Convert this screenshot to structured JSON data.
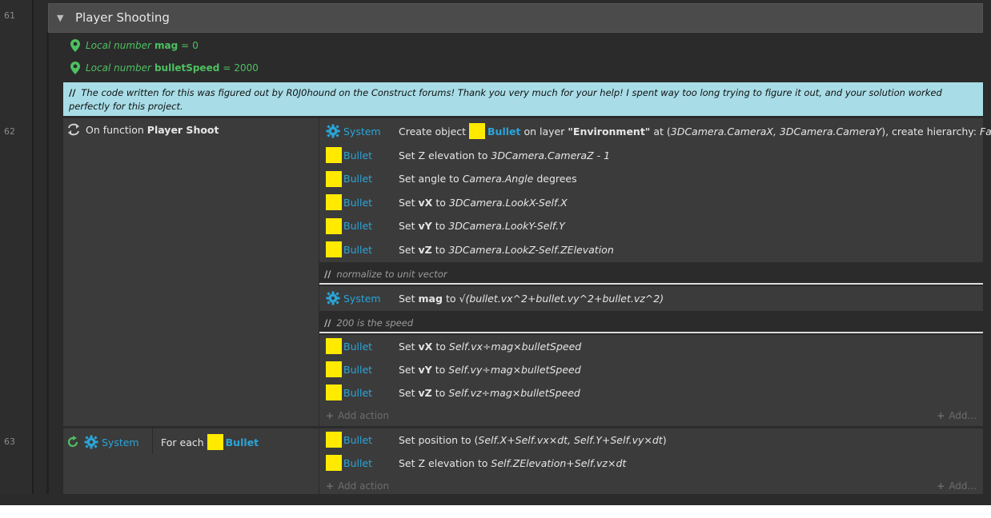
{
  "line_numbers": {
    "group": "61",
    "event62": "62",
    "event63": "63"
  },
  "group": {
    "title": "Player Shooting"
  },
  "local_vars": [
    {
      "prefix": "Local number",
      "name": "mag",
      "eq": "=",
      "value": "0"
    },
    {
      "prefix": "Local number",
      "name": "bulletSpeed",
      "eq": "=",
      "value": "2000"
    }
  ],
  "comment": {
    "slashes": "//",
    "text": "The code written for this was figured out by R0J0hound on the Construct forums! Thank you very much for your help! I spent way too long trying to figure it out, and your solution worked perfectly for this project."
  },
  "event62": {
    "condition_prefix": "On function",
    "function_name": "Player Shoot",
    "create_action": {
      "object": "System",
      "t1": "Create object",
      "obj": "Bullet",
      "t2": "on layer",
      "layer": "\"Environment\"",
      "t3": "at (",
      "coords": "3DCamera.CameraX, 3DCamera.CameraY",
      "t4": "), create hierarchy:",
      "hierarchy": "False"
    },
    "actions_a": [
      {
        "object": "Bullet",
        "pre": "Set Z elevation to",
        "bold": "",
        "mid": "",
        "expr": "3DCamera.CameraZ - 1",
        "post": ""
      },
      {
        "object": "Bullet",
        "pre": "Set angle to",
        "bold": "",
        "mid": "",
        "expr": "Camera.Angle",
        "post": "degrees"
      },
      {
        "object": "Bullet",
        "pre": "Set",
        "bold": "vX",
        "mid": "to",
        "expr": "3DCamera.LookX-Self.X",
        "post": ""
      },
      {
        "object": "Bullet",
        "pre": "Set",
        "bold": "vY",
        "mid": "to",
        "expr": "3DCamera.LookY-Self.Y",
        "post": ""
      },
      {
        "object": "Bullet",
        "pre": "Set",
        "bold": "vZ",
        "mid": "to",
        "expr": "3DCamera.LookZ-Self.ZElevation",
        "post": ""
      }
    ],
    "comment_normalize": "normalize to unit vector",
    "mag_action": {
      "object": "System",
      "pre": "Set",
      "bold": "mag",
      "mid": "to",
      "expr": "√(bullet.vx^2+bullet.vy^2+bullet.vz^2)"
    },
    "comment_speed": "200 is the speed",
    "actions_b": [
      {
        "object": "Bullet",
        "pre": "Set",
        "bold": "vX",
        "mid": "to",
        "expr": "Self.vx÷mag×bulletSpeed"
      },
      {
        "object": "Bullet",
        "pre": "Set",
        "bold": "vY",
        "mid": "to",
        "expr": "Self.vy÷mag×bulletSpeed"
      },
      {
        "object": "Bullet",
        "pre": "Set",
        "bold": "vZ",
        "mid": "to",
        "expr": "Self.vz÷mag×bulletSpeed"
      }
    ],
    "add_action": "Add action",
    "add_more": "Add..."
  },
  "event63": {
    "condition_object": "System",
    "condition_text": "For each",
    "condition_obj": "Bullet",
    "actions": [
      {
        "object": "Bullet",
        "pre": "Set position to (",
        "expr": "Self.X+Self.vx×dt, Self.Y+Self.vy×dt",
        "post": ")"
      },
      {
        "object": "Bullet",
        "pre": "Set Z elevation to",
        "expr": "Self.ZElevation+Self.vz×dt",
        "post": ""
      }
    ],
    "add_action": "Add action",
    "add_more": "Add..."
  },
  "colors": {
    "accent_object": "#2aa5d8",
    "local_var_green": "#4ec061",
    "comment_bg": "#a8dde7",
    "object_square": "#ffea00"
  },
  "icons": [
    "triangle-down-icon",
    "location-pin-icon",
    "function-loop-icon",
    "gear-icon",
    "for-each-loop-icon",
    "plus-icon"
  ]
}
